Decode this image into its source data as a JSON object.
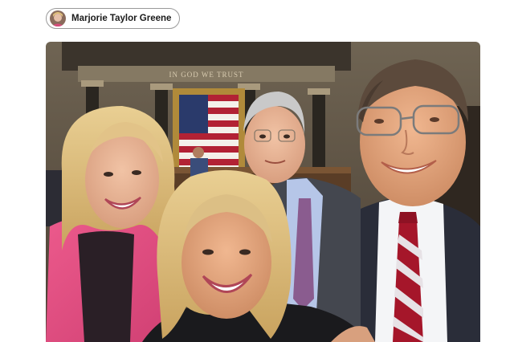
{
  "post": {
    "author": "Marjorie Taylor Greene",
    "avatar_icon": "profile-avatar",
    "inscription": "IN GOD WE TRUST",
    "photo_icon": "selfie-photo"
  },
  "colors": {
    "chip_border": "#9a9a9a",
    "text": "#1a1a1a",
    "jacket_pink": "#e0487c",
    "suit_navy": "#2a2d39",
    "tie_red": "#a5162a"
  }
}
